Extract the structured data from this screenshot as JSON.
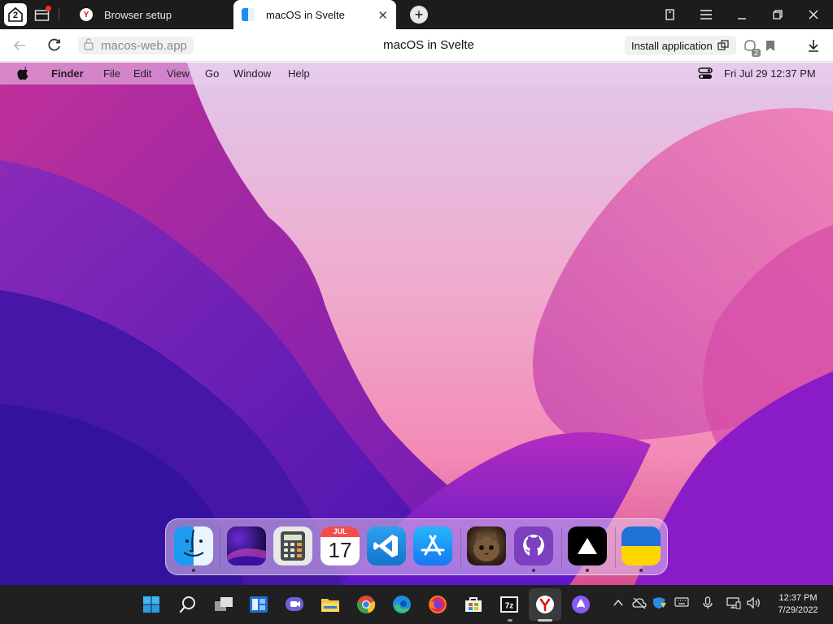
{
  "browser": {
    "home_count": "2",
    "tabs": [
      {
        "label": "Browser setup",
        "favicon": "yandex-icon",
        "active": false
      },
      {
        "label": "macOS in Svelte",
        "favicon": "finder-icon",
        "active": true
      }
    ],
    "address": {
      "url": "macos-web.app",
      "page_title": "macOS in Svelte",
      "install_label": "Install application",
      "extensions_badge": "2"
    }
  },
  "macos": {
    "menubar": {
      "app_name": "Finder",
      "menus": [
        "File",
        "Edit",
        "View",
        "Go",
        "Window",
        "Help"
      ],
      "clock": "Fri Jul 29   12:37 PM"
    },
    "dock": {
      "apps": [
        {
          "name": "finder",
          "running": true
        },
        {
          "name": "wallpapers",
          "running": false
        },
        {
          "name": "calculator",
          "running": false
        },
        {
          "name": "calendar",
          "running": false,
          "month": "JUL",
          "day": "17"
        },
        {
          "name": "vscode",
          "running": false
        },
        {
          "name": "app-store",
          "running": false
        },
        {
          "name": "purrple-cat",
          "running": false
        },
        {
          "name": "github",
          "running": true
        },
        {
          "name": "vercel",
          "running": true
        },
        {
          "name": "ukraine",
          "running": true
        }
      ]
    }
  },
  "taskbar": {
    "time": "12:37 PM",
    "date": "7/29/2022"
  },
  "colors": {
    "tab_strip": "#1c1c1c",
    "taskbar": "#202020",
    "wallpaper_main": "#7a1fd0",
    "wallpaper_pink": "#f07ab8"
  }
}
